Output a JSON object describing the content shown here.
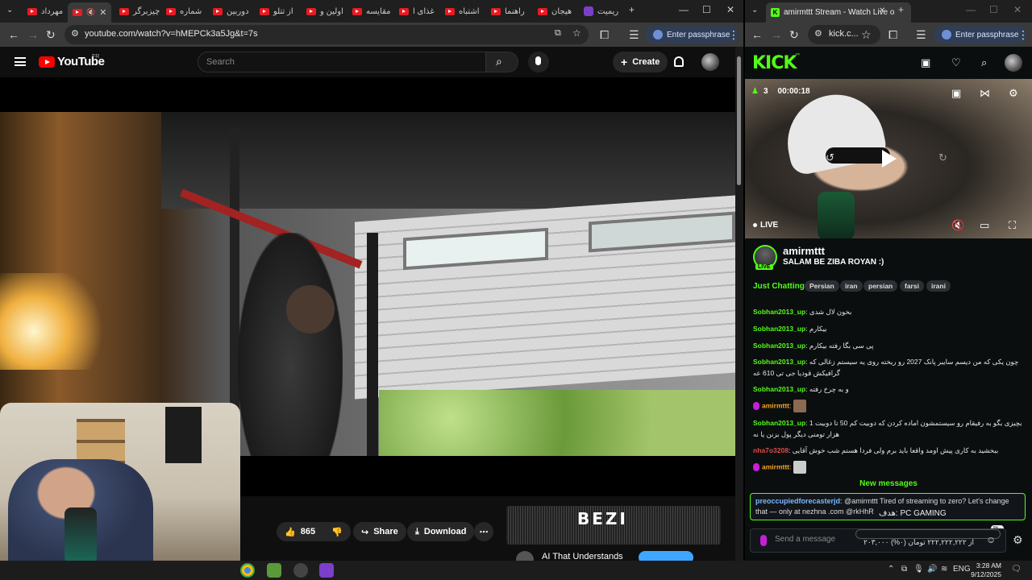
{
  "left_browser": {
    "tabs": [
      {
        "label": "مهرداد"
      },
      {
        "label": ""
      },
      {
        "label": "چیزبرگر"
      },
      {
        "label": "شماره"
      },
      {
        "label": "دوربین"
      },
      {
        "label": "از تتلو"
      },
      {
        "label": "اولین و"
      },
      {
        "label": "مقایسه"
      },
      {
        "label": "غذای ا"
      },
      {
        "label": "اشتباه"
      },
      {
        "label": "راهنما"
      },
      {
        "label": "هیجان"
      },
      {
        "label": "ریمیت"
      }
    ],
    "url": "youtube.com/watch?v=hMEPCk3a5Jg&t=7s",
    "passphrase_label": "Enter passphrase"
  },
  "youtube": {
    "logo_text": "YouTube",
    "region": "FR",
    "search_placeholder": "Search",
    "create_label": "Create",
    "likes": "865",
    "share_label": "Share",
    "download_label": "Download",
    "ad_logo": "BEZI",
    "recommended_title": "AI That Understands"
  },
  "right_browser": {
    "tab_title": "amirmttt Stream - Watch Live o",
    "url": "kick.c...",
    "passphrase_label": "Enter passphrase"
  },
  "kick": {
    "logo": "KICK",
    "viewers": "3",
    "uptime": "00:00:18",
    "live_label": "LIVE",
    "channel_name": "amirmttt",
    "stream_title": "SALAM BE ZIBA ROYAN :)",
    "avatar_live_badge": "LIVE",
    "category": "Just Chatting",
    "tags": [
      "Persian",
      "iran",
      "persian",
      "farsi",
      "irani"
    ],
    "chat": [
      {
        "user": "Sobhan2013_up",
        "user_color": "#53fc18",
        "text": "بخون لال شدی"
      },
      {
        "user": "Sobhan2013_up",
        "user_color": "#53fc18",
        "text": "بیکارم"
      },
      {
        "user": "Sobhan2013_up",
        "user_color": "#53fc18",
        "text": "پی سی بگا رفته بیکارم"
      },
      {
        "user": "Sobhan2013_up",
        "user_color": "#53fc18",
        "text": "چون یکی که من دیسم سایبر پانک 2027 رو ریخته روی یه سیستم زغالی که گرافیکش قودیا جی تی 610 عه"
      },
      {
        "user": "Sobhan2013_up",
        "user_color": "#53fc18",
        "text": "و به چرخ رفته"
      },
      {
        "user": "amirmttt",
        "user_color": "#f5a623",
        "text": ""
      },
      {
        "user": "Sobhan2013_up",
        "user_color": "#53fc18",
        "text": "بچیزی بگو به رفیقام رو سیستمشون اماده کردن که دوبیت کم 50 تا دوبیت 1 هزار تومنی دیگر پول بزنن یا نه"
      },
      {
        "user": "nha7o3208",
        "user_color": "#e04a4a",
        "text": "ببخشید به کاری پیش اومد واقعا باید برم ولی فردا هستم شب خوش آقایی"
      },
      {
        "user": "amirmttt",
        "user_color": "#f5a623",
        "text": ""
      }
    ],
    "new_messages_label": "New messages",
    "pinned_user": "preoccupiedforecasterjd",
    "pinned_text": "@amirmttt Tired of streaming to zero? Let's change that — only at nezhna .com @rkHhR",
    "goal_label": "PC GAMING :هدف",
    "goal_progress": "۲۰۳,۰۰۰ از ۲۲۲,۲۲۲,۲۲۲ تومان (۰%)",
    "goal_percent_badge": "%۰",
    "chat_placeholder": "Send a message"
  },
  "taskbar": {
    "language": "ENG",
    "time": "3:28 AM",
    "date": "9/12/2025"
  },
  "colors": {
    "kick_green": "#53fc18",
    "youtube_red": "#ff0000",
    "chrome_dark": "#1f1f1f"
  }
}
